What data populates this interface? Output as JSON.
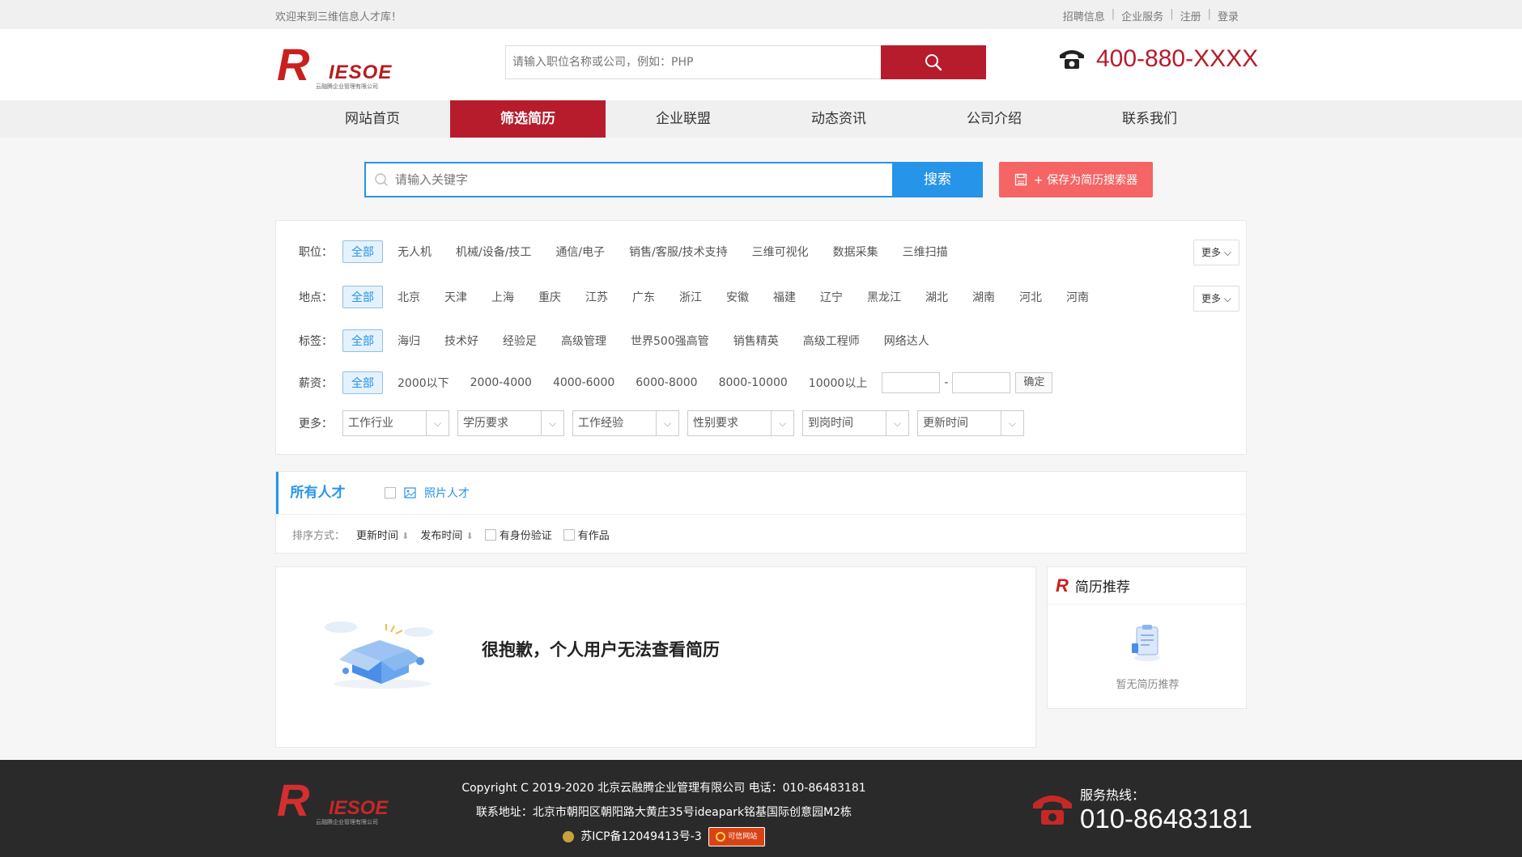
{
  "topbar": {
    "welcome": "欢迎来到三维信息人才库！",
    "links": [
      "招聘信息",
      "企业服务",
      "注册",
      "登录"
    ]
  },
  "header": {
    "logo_letter": "R",
    "logo_word": "IESOE",
    "logo_sub": "云融腾企业管理有限公司",
    "search_placeholder": "请输入职位名称或公司，例如：PHP",
    "phone": "400-880-XXXX"
  },
  "nav": {
    "items": [
      "网站首页",
      "筛选简历",
      "企业联盟",
      "动态资讯",
      "公司介绍",
      "联系我们"
    ],
    "active_index": 1
  },
  "keyword_search": {
    "placeholder": "请输入关键字",
    "button": "搜索",
    "save_button": "+ 保存为简历搜索器"
  },
  "filters": {
    "position": {
      "label": "职位：",
      "options": [
        "全部",
        "无人机",
        "机械/设备/技工",
        "通信/电子",
        "销售/客服/技术支持",
        "三维可视化",
        "数据采集",
        "三维扫描"
      ],
      "more": "更多"
    },
    "location": {
      "label": "地点：",
      "options": [
        "全部",
        "北京",
        "天津",
        "上海",
        "重庆",
        "江苏",
        "广东",
        "浙江",
        "安徽",
        "福建",
        "辽宁",
        "黑龙江",
        "湖北",
        "湖南",
        "河北",
        "河南"
      ],
      "more": "更多"
    },
    "tags": {
      "label": "标签：",
      "options": [
        "全部",
        "海归",
        "技术好",
        "经验足",
        "高级管理",
        "世界500强高管",
        "销售精英",
        "高级工程师",
        "网络达人"
      ]
    },
    "salary": {
      "label": "薪资：",
      "options": [
        "全部",
        "2000以下",
        "2000-4000",
        "4000-6000",
        "6000-8000",
        "8000-10000",
        "10000以上"
      ],
      "range_sep": "-",
      "confirm": "确定"
    },
    "more": {
      "label": "更多：",
      "selects": [
        "工作行业",
        "学历要求",
        "工作经验",
        "性别要求",
        "到岗时间",
        "更新时间"
      ]
    }
  },
  "tabs": {
    "all": "所有人才",
    "photo": "照片人才",
    "sort_label": "排序方式：",
    "sort_update": "更新时间",
    "sort_publish": "发布时间",
    "check_id": "有身份验证",
    "check_works": "有作品"
  },
  "content": {
    "message": "很抱歉，个人用户无法查看简历"
  },
  "side": {
    "title_letter": "R",
    "title": "简历推荐",
    "empty": "暂无简历推荐"
  },
  "footer": {
    "copyright": "Copyright C 2019-2020 北京云融腾企业管理有限公司 电话：010-86483181",
    "address": "联系地址：北京市朝阳区朝阳路大黄庄35号ideapark铭基国际创意园M2栋",
    "icp": "苏ICP备12049413号-3",
    "badge": "可信网站",
    "hotline_label": "服务热线：",
    "hotline": "010-86483181"
  },
  "colors": {
    "brand_red": "#b71c2c",
    "accent_blue": "#2694e8",
    "save_red": "#f56565"
  }
}
